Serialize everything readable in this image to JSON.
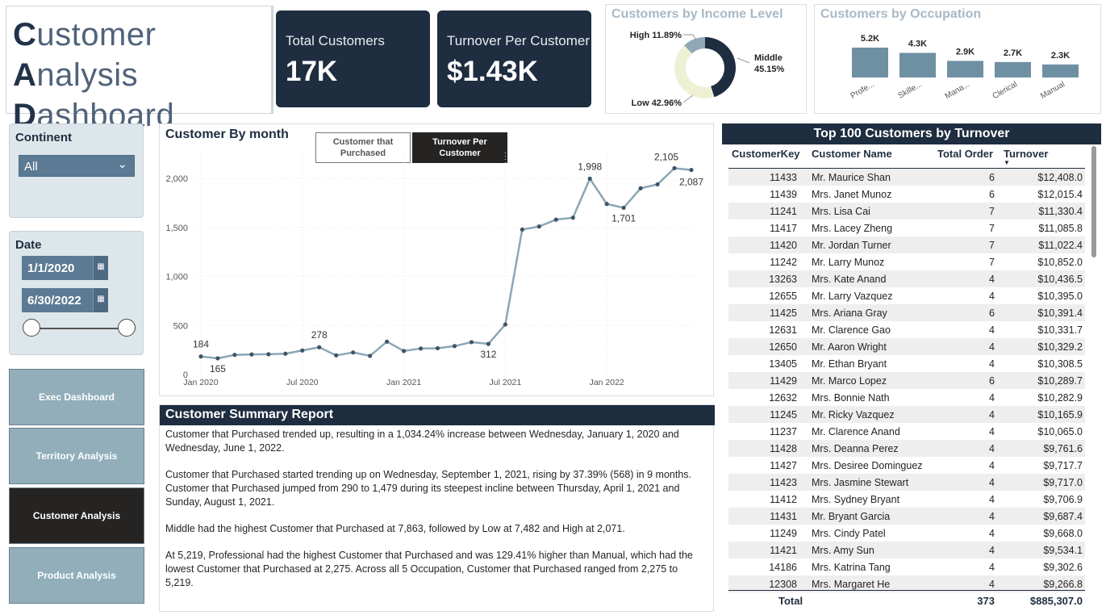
{
  "title": {
    "line1_cap1": "C",
    "line1_rest1": "ustomer ",
    "line1_cap2": "A",
    "line1_rest2": "nalysis",
    "line2_cap": "D",
    "line2_rest": "ashboard"
  },
  "kpis": [
    {
      "label": "Total Customers",
      "value": "17K"
    },
    {
      "label": "Turnover Per Customer",
      "value": "$1.43K"
    }
  ],
  "income_chart": {
    "title": "Customers by Income Level",
    "slices": [
      {
        "name": "Middle",
        "pct": 45.15,
        "label": "45.15%",
        "color": "#1e2d40"
      },
      {
        "name": "Low",
        "pct": 42.96,
        "label": "42.96%",
        "color": "#eef0d4"
      },
      {
        "name": "High",
        "pct": 11.89,
        "label": "11.89%",
        "color": "#8fa9b8"
      }
    ]
  },
  "occupation_chart": {
    "title": "Customers by Occupation",
    "bars": [
      {
        "category": "Profe...",
        "value": 5219,
        "label": "5.2K"
      },
      {
        "category": "Skille...",
        "value": 4300,
        "label": "4.3K"
      },
      {
        "category": "Mana...",
        "value": 2900,
        "label": "2.9K"
      },
      {
        "category": "Clerical",
        "value": 2700,
        "label": "2.7K"
      },
      {
        "category": "Manual",
        "value": 2275,
        "label": "2.3K"
      }
    ],
    "color": "#6f8fa3"
  },
  "filters": {
    "continent_label": "Continent",
    "continent_value": "All",
    "date_label": "Date",
    "date_start": "1/1/2020",
    "date_end": "6/30/2022"
  },
  "nav": [
    {
      "label": "Exec Dashboard",
      "active": false
    },
    {
      "label": "Territory Analysis",
      "active": false
    },
    {
      "label": "Customer Analysis",
      "active": true
    },
    {
      "label": "Product Analysis",
      "active": false
    }
  ],
  "line_chart": {
    "title": "Customer By month",
    "toggle_off": "Customer that Purchased",
    "toggle_on": "Turnover Per Customer"
  },
  "chart_data": {
    "type": "line",
    "title": "Customer By month",
    "x": [
      "2020-01",
      "2020-02",
      "2020-03",
      "2020-04",
      "2020-05",
      "2020-06",
      "2020-07",
      "2020-08",
      "2020-09",
      "2020-10",
      "2020-11",
      "2020-12",
      "2021-01",
      "2021-02",
      "2021-03",
      "2021-04",
      "2021-05",
      "2021-06",
      "2021-07",
      "2021-08",
      "2021-09",
      "2021-10",
      "2021-11",
      "2021-12",
      "2022-01",
      "2022-02",
      "2022-03",
      "2022-04",
      "2022-05",
      "2022-06"
    ],
    "series": [
      {
        "values": [
          184,
          165,
          200,
          205,
          207,
          212,
          245,
          278,
          195,
          225,
          190,
          335,
          240,
          265,
          268,
          290,
          330,
          312,
          510,
          1479,
          1510,
          1580,
          1600,
          1998,
          1740,
          1701,
          1900,
          1940,
          2105,
          2087
        ]
      }
    ],
    "data_labels": {
      "0": "184",
      "1": "165",
      "7": "278",
      "17": "312",
      "23": "1,998",
      "25": "1,701",
      "28": "2,105",
      "29": "2,087"
    },
    "x_ticks": [
      "Jan 2020",
      "Jul 2020",
      "Jan 2021",
      "Jul 2021",
      "Jan 2022"
    ],
    "y_ticks": [
      "0",
      "500",
      "1,000",
      "1,500",
      "2,000"
    ],
    "ylim": [
      0,
      2100
    ],
    "color": "#8aa7b5",
    "grid": true
  },
  "summary": {
    "title": "Customer Summary Report",
    "paragraphs": [
      "Customer that Purchased trended up, resulting in a 1,034.24% increase between Wednesday, January 1, 2020 and Wednesday, June 1, 2022.",
      "Customer that Purchased started trending up on Wednesday, September 1, 2021, rising by 37.39% (568) in 9 months. Customer that Purchased jumped from 290 to 1,479 during its steepest incline between Thursday, April 1, 2021 and Sunday, August 1, 2021.",
      "Middle had the highest Customer that Purchased at 7,863, followed by Low at 7,482 and High at 2,071.",
      "At 5,219, Professional had the highest Customer that Purchased and was 129.41% higher than Manual, which had the lowest Customer that Purchased at 2,275. Across all 5 Occupation, Customer that Purchased ranged from 2,275 to 5,219."
    ]
  },
  "table": {
    "title": "Top 100 Customers by Turnover",
    "columns": [
      "CustomerKey",
      "Customer Name",
      "Total Order",
      "Turnover"
    ],
    "rows": [
      [
        "11433",
        "Mr. Maurice Shan",
        "6",
        "$12,408.0"
      ],
      [
        "11439",
        "Mrs. Janet Munoz",
        "6",
        "$12,015.4"
      ],
      [
        "11241",
        "Mrs. Lisa Cai",
        "7",
        "$11,330.4"
      ],
      [
        "11417",
        "Mrs. Lacey Zheng",
        "7",
        "$11,085.8"
      ],
      [
        "11420",
        "Mr. Jordan Turner",
        "7",
        "$11,022.4"
      ],
      [
        "11242",
        "Mr. Larry Munoz",
        "7",
        "$10,852.0"
      ],
      [
        "13263",
        "Mrs. Kate Anand",
        "4",
        "$10,436.5"
      ],
      [
        "12655",
        "Mr. Larry Vazquez",
        "4",
        "$10,395.0"
      ],
      [
        "11425",
        "Mrs. Ariana Gray",
        "6",
        "$10,391.4"
      ],
      [
        "12631",
        "Mr. Clarence Gao",
        "4",
        "$10,331.7"
      ],
      [
        "12650",
        "Mr. Aaron Wright",
        "4",
        "$10,329.2"
      ],
      [
        "13405",
        "Mr. Ethan Bryant",
        "4",
        "$10,308.5"
      ],
      [
        "11429",
        "Mr. Marco Lopez",
        "6",
        "$10,289.7"
      ],
      [
        "12632",
        "Mrs. Bonnie Nath",
        "4",
        "$10,282.9"
      ],
      [
        "11245",
        "Mr. Ricky Vazquez",
        "4",
        "$10,165.9"
      ],
      [
        "11237",
        "Mr. Clarence Anand",
        "4",
        "$10,065.0"
      ],
      [
        "11428",
        "Mrs. Deanna Perez",
        "4",
        "$9,761.6"
      ],
      [
        "11427",
        "Mrs. Desiree Dominguez",
        "4",
        "$9,717.7"
      ],
      [
        "11423",
        "Mrs. Jasmine Stewart",
        "4",
        "$9,717.0"
      ],
      [
        "11412",
        "Mrs. Sydney Bryant",
        "4",
        "$9,706.9"
      ],
      [
        "11431",
        "Mr. Bryant Garcia",
        "4",
        "$9,687.4"
      ],
      [
        "11249",
        "Mrs. Cindy Patel",
        "4",
        "$9,668.0"
      ],
      [
        "11421",
        "Mrs. Amy Sun",
        "4",
        "$9,534.1"
      ],
      [
        "14186",
        "Mrs. Katrina Tang",
        "4",
        "$9,302.6"
      ],
      [
        "12308",
        "Mrs. Margaret He",
        "4",
        "$9,266.8"
      ]
    ],
    "total_label": "Total",
    "total_orders": "373",
    "total_turnover": "$885,307.0"
  }
}
